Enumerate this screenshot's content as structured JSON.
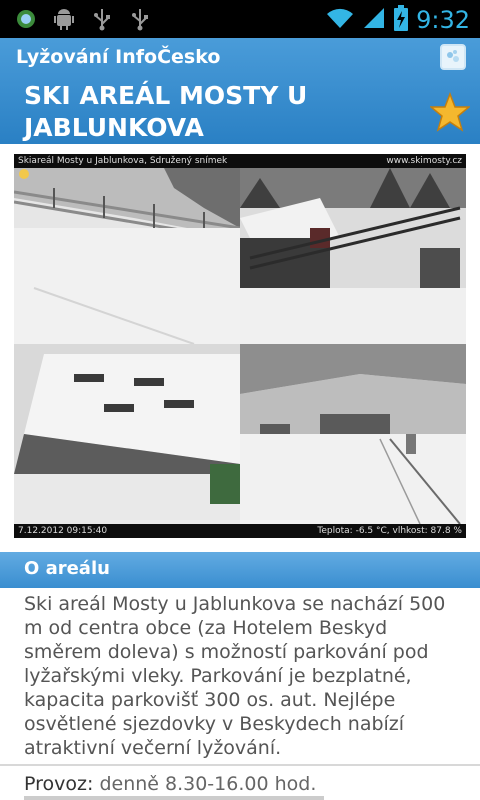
{
  "status_bar": {
    "time": "9:32",
    "icons": [
      "app-notification-icon",
      "android-debug-icon",
      "usb-icon",
      "usb-icon",
      "wifi-icon",
      "signal-icon",
      "battery-charging-icon"
    ]
  },
  "app_bar": {
    "app_title": "Lyžování InfoČesko",
    "page_title": "SKI AREÁL MOSTY U JABLUNKOVA",
    "favorite_icon": "star-icon"
  },
  "webcam": {
    "caption_left": "Skiareál Mosty u Jablunkova, Sdružený snímek",
    "caption_right": "www.skimosty.cz",
    "timestamp": "7.12.2012  09:15:40",
    "weather": "Teplota: -6.5 °C, vlhkost: 87.8 %"
  },
  "about": {
    "heading": "O areálu",
    "text": "Ski areál Mosty u Jablunkova se nachází 500 m od centra obce (za Hotelem Beskyd směrem doleva) s možností parkování pod lyžařskými vleky. Parkování je bezplatné, kapacita parkovišť 300 os. aut. Nejlépe osvětlené sjezdovky v Beskydech nabízí atraktivní večerní lyžování.",
    "provoz_label": "Provoz:",
    "provoz_value": "denně 8.30-16.00 hod."
  },
  "colors": {
    "accent": "#33b5e5",
    "appbar": "#2a80c4",
    "section": "#3a8ed0",
    "star": "#f5b82e"
  }
}
